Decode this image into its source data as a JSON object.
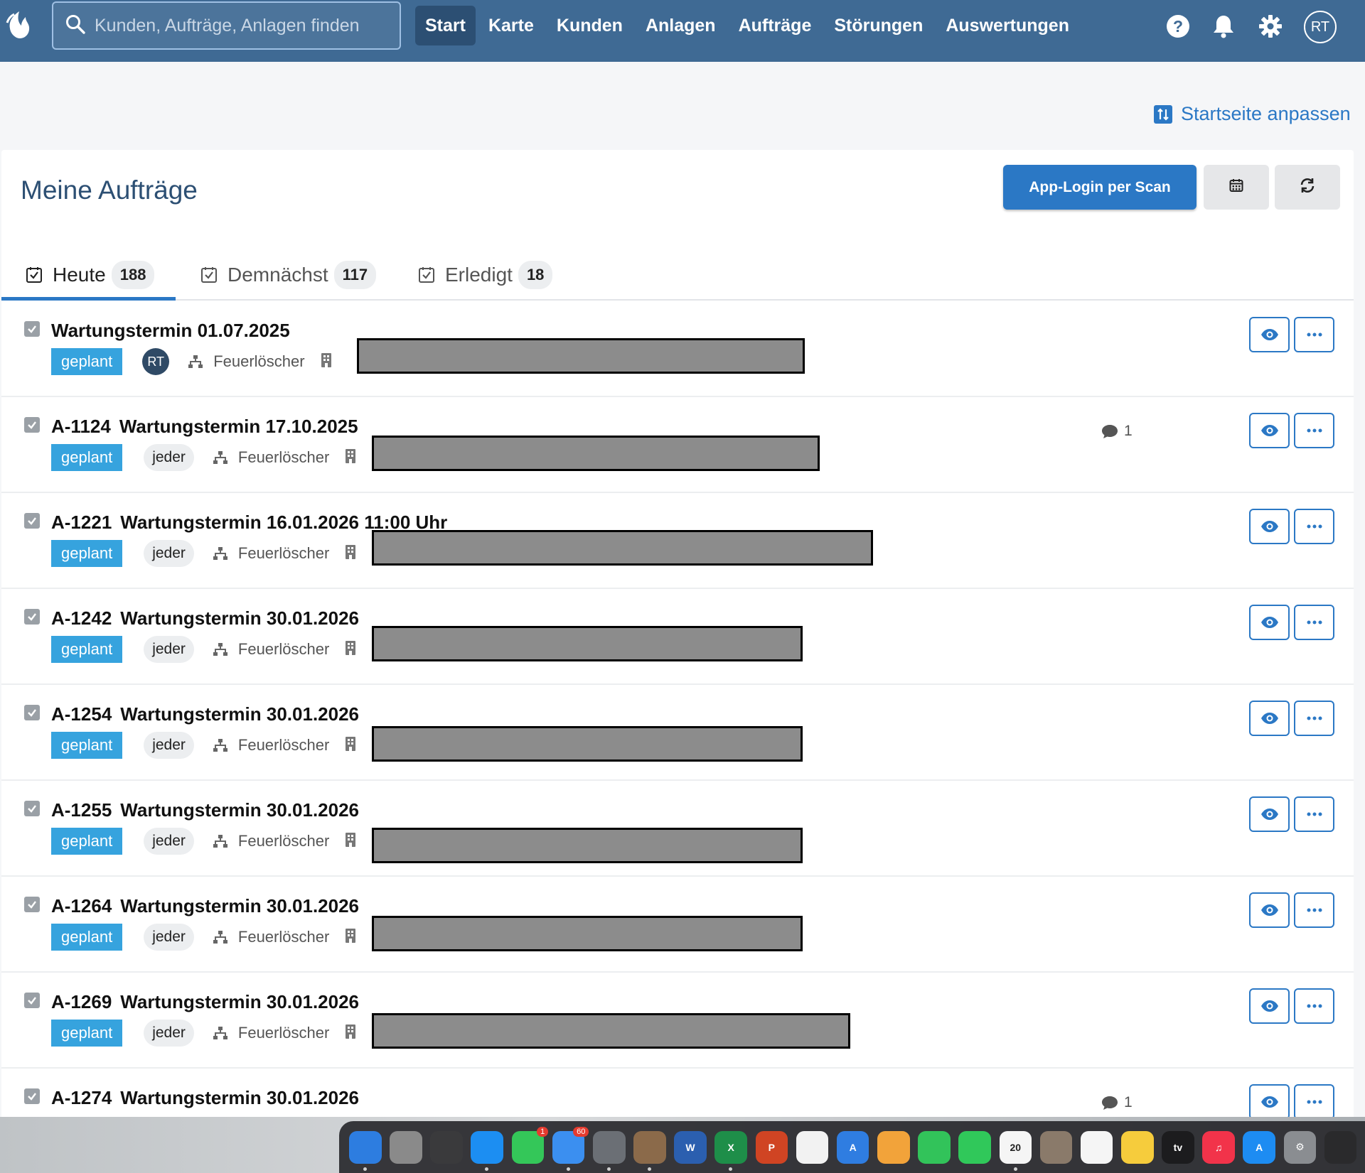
{
  "topbar": {
    "search_placeholder": "Kunden, Aufträge, Anlagen finden",
    "nav": [
      "Start",
      "Karte",
      "Kunden",
      "Anlagen",
      "Aufträge",
      "Störungen",
      "Auswertungen"
    ],
    "active_nav": "Start",
    "user_initials": "RT"
  },
  "customize_label": "Startseite anpassen",
  "card": {
    "title": "Meine Aufträge",
    "app_login_label": "App-Login per Scan"
  },
  "tabs": [
    {
      "label": "Heute",
      "count": "188"
    },
    {
      "label": "Demnächst",
      "count": "117"
    },
    {
      "label": "Erledigt",
      "count": "18"
    }
  ],
  "orders": [
    {
      "number": "",
      "title": "Wartungstermin 01.07.2025",
      "status": "geplant",
      "assignee": "RT",
      "category": "Feuerlöscher",
      "comments": ""
    },
    {
      "number": "A-1124",
      "title": "Wartungstermin 17.10.2025",
      "status": "geplant",
      "assignee": "jeder",
      "category": "Feuerlöscher",
      "comments": "1"
    },
    {
      "number": "A-1221",
      "title": "Wartungstermin 16.01.2026 11:00 Uhr",
      "status": "geplant",
      "assignee": "jeder",
      "category": "Feuerlöscher",
      "comments": ""
    },
    {
      "number": "A-1242",
      "title": "Wartungstermin 30.01.2026",
      "status": "geplant",
      "assignee": "jeder",
      "category": "Feuerlöscher",
      "comments": ""
    },
    {
      "number": "A-1254",
      "title": "Wartungstermin 30.01.2026",
      "status": "geplant",
      "assignee": "jeder",
      "category": "Feuerlöscher",
      "comments": ""
    },
    {
      "number": "A-1255",
      "title": "Wartungstermin 30.01.2026",
      "status": "geplant",
      "assignee": "jeder",
      "category": "Feuerlöscher",
      "comments": ""
    },
    {
      "number": "A-1264",
      "title": "Wartungstermin 30.01.2026",
      "status": "geplant",
      "assignee": "jeder",
      "category": "Feuerlöscher",
      "comments": ""
    },
    {
      "number": "A-1269",
      "title": "Wartungstermin 30.01.2026",
      "status": "geplant",
      "assignee": "jeder",
      "category": "Feuerlöscher",
      "comments": ""
    },
    {
      "number": "A-1274",
      "title": "Wartungstermin 30.01.2026",
      "status": "",
      "assignee": "",
      "category": "",
      "comments": "1"
    }
  ],
  "dock": [
    {
      "name": "finder-icon",
      "color": "#2d7de0",
      "label": "",
      "badge": ""
    },
    {
      "name": "calculator-icon",
      "color": "#8a8a8a",
      "label": "",
      "badge": ""
    },
    {
      "name": "launchpad-icon",
      "color": "#3a3a3c",
      "label": "",
      "badge": ""
    },
    {
      "name": "safari-icon",
      "color": "#1c8ef2",
      "label": "",
      "badge": ""
    },
    {
      "name": "messages-icon",
      "color": "#34c759",
      "label": "",
      "badge": "1"
    },
    {
      "name": "mail-icon",
      "color": "#3b8ff0",
      "label": "",
      "badge": "60"
    },
    {
      "name": "disk-utility-icon",
      "color": "#6b6f75",
      "label": "",
      "badge": ""
    },
    {
      "name": "script-editor-icon",
      "color": "#8b6a4a",
      "label": "",
      "badge": ""
    },
    {
      "name": "word-icon",
      "color": "#2b5faf",
      "label": "W",
      "badge": ""
    },
    {
      "name": "excel-icon",
      "color": "#1e8e49",
      "label": "X",
      "badge": ""
    },
    {
      "name": "powerpoint-icon",
      "color": "#d04423",
      "label": "P",
      "badge": ""
    },
    {
      "name": "freeform-icon",
      "color": "#f2f2f2",
      "label": "",
      "badge": ""
    },
    {
      "name": "instruments-icon",
      "color": "#2f7de1",
      "label": "A",
      "badge": ""
    },
    {
      "name": "photos-icon",
      "color": "#f2a33a",
      "label": "",
      "badge": ""
    },
    {
      "name": "facetime-icon",
      "color": "#32c35a",
      "label": "",
      "badge": ""
    },
    {
      "name": "phone-icon",
      "color": "#30c85a",
      "label": "",
      "badge": ""
    },
    {
      "name": "calendar-icon",
      "color": "#f5f5f5",
      "label": "20",
      "badge": ""
    },
    {
      "name": "contacts-icon",
      "color": "#8a7a6a",
      "label": "",
      "badge": ""
    },
    {
      "name": "reminders-icon",
      "color": "#f5f5f5",
      "label": "",
      "badge": ""
    },
    {
      "name": "notes-icon",
      "color": "#f6cc3c",
      "label": "",
      "badge": ""
    },
    {
      "name": "tv-icon",
      "color": "#1c1c1e",
      "label": "tv",
      "badge": ""
    },
    {
      "name": "music-icon",
      "color": "#f2334a",
      "label": "♫",
      "badge": ""
    },
    {
      "name": "app-store-icon",
      "color": "#1d8cf2",
      "label": "A",
      "badge": ""
    },
    {
      "name": "system-settings-icon",
      "color": "#8a8d91",
      "label": "⚙",
      "badge": ""
    },
    {
      "name": "activity-monitor-icon",
      "color": "#2a2a2c",
      "label": "",
      "badge": ""
    }
  ]
}
